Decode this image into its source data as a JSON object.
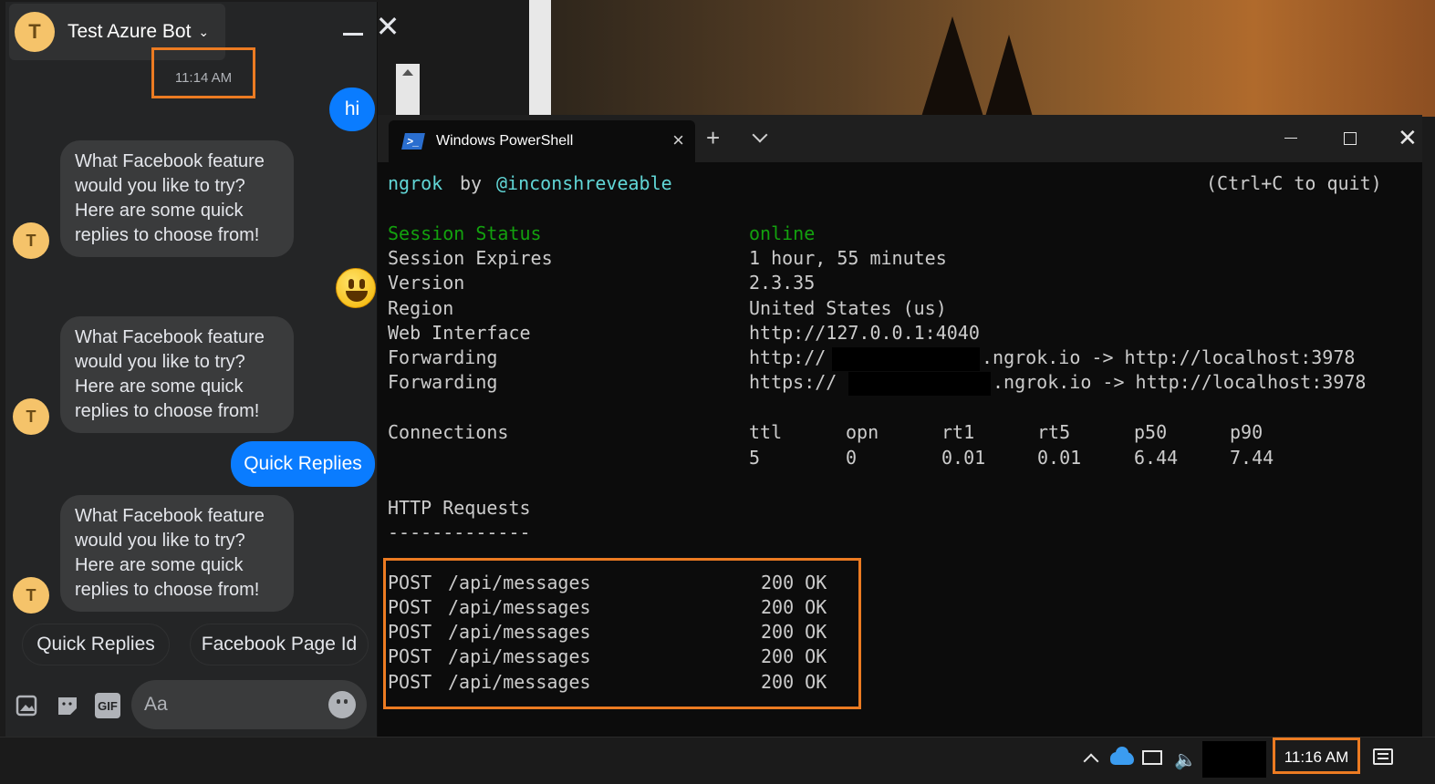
{
  "chat": {
    "title": "Test Azure Bot",
    "avatar_letter": "T",
    "timestamp": "11:14 AM",
    "messages": [
      {
        "dir": "out",
        "text": "hi"
      },
      {
        "dir": "in",
        "text": "What Facebook feature would you like to try? Here are some quick replies to choose from!"
      },
      {
        "dir": "out",
        "text": "😀"
      },
      {
        "dir": "in",
        "text": "What Facebook feature would you like to try? Here are some quick replies to choose from!"
      },
      {
        "dir": "out",
        "text": "Quick Replies"
      },
      {
        "dir": "in",
        "text": "What Facebook feature would you like to try? Here are some quick replies to choose from!"
      }
    ],
    "quick_replies": [
      "Quick Replies",
      "Facebook Page Id"
    ],
    "composer": {
      "placeholder": "Aa",
      "icons": [
        "image-icon",
        "sticker-icon",
        "gif-icon",
        "emoji-icon"
      ],
      "gif_label": "GIF"
    }
  },
  "terminal": {
    "tab_title": "Windows PowerShell",
    "header_left": "ngrok",
    "header_by": "by",
    "header_author": "@inconshreveable",
    "header_right": "(Ctrl+C to quit)",
    "session_status_label": "Session Status",
    "session_status_value": "online",
    "rows": [
      {
        "label": "Session Expires",
        "value": "1 hour, 55 minutes"
      },
      {
        "label": "Version",
        "value": "2.3.35"
      },
      {
        "label": "Region",
        "value": "United States (us)"
      },
      {
        "label": "Web Interface",
        "value": "http://127.0.0.1:4040"
      }
    ],
    "forwarding": [
      {
        "label": "Forwarding",
        "prefix": "http://",
        "suffix": ".ngrok.io -> http://localhost:3978"
      },
      {
        "label": "Forwarding",
        "prefix": "https://",
        "suffix": ".ngrok.io -> http://localhost:3978"
      }
    ],
    "connections": {
      "label": "Connections",
      "headers": [
        "ttl",
        "opn",
        "rt1",
        "rt5",
        "p50",
        "p90"
      ],
      "values": [
        "5",
        "0",
        "0.01",
        "0.01",
        "6.44",
        "7.44"
      ]
    },
    "http_requests_title": "HTTP Requests",
    "http_requests_rule": "-------------",
    "requests": [
      {
        "method": "POST",
        "path": "/api/messages",
        "status": "200 OK"
      },
      {
        "method": "POST",
        "path": "/api/messages",
        "status": "200 OK"
      },
      {
        "method": "POST",
        "path": "/api/messages",
        "status": "200 OK"
      },
      {
        "method": "POST",
        "path": "/api/messages",
        "status": "200 OK"
      },
      {
        "method": "POST",
        "path": "/api/messages",
        "status": "200 OK"
      }
    ]
  },
  "taskbar": {
    "clock": "11:16 AM"
  },
  "colors": {
    "highlight": "#ec7b22",
    "messenger_blue": "#0a7cff",
    "terminal_green": "#13a10e",
    "terminal_cyan": "#61d6d6"
  }
}
